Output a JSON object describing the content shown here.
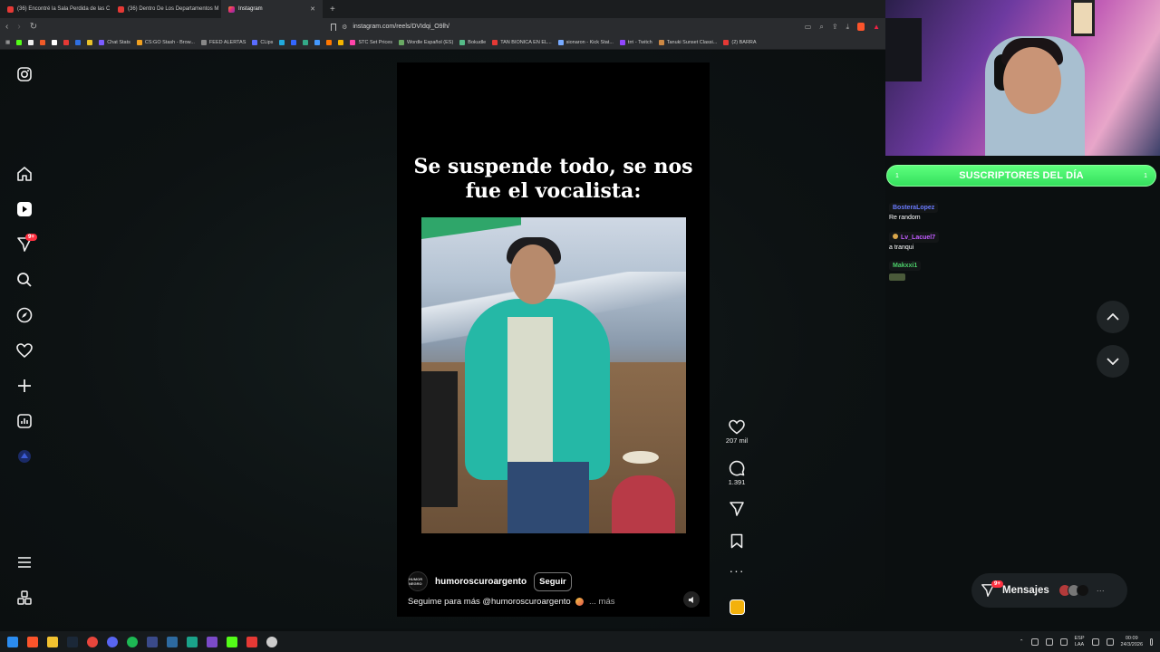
{
  "browser": {
    "tabs": [
      {
        "label": "(36) Encontré la Sala Perdida de las C",
        "active": false
      },
      {
        "label": "(36) Dentro De Los Departamentos M",
        "active": false
      },
      {
        "label": "Instagram",
        "active": true
      }
    ],
    "new_tab_label": "+",
    "url": "instagram.com/reels/DVIdqi_O9lh/",
    "bookmarks": [
      "Chat Stats",
      "CS:GO Stash - Brow...",
      "FEED ALERTAS",
      "CLips",
      "STC Set Prices",
      "Wordle Español (ES)",
      "Bokudle",
      "TAN BIONICA EN EL...",
      "sionaron - Kick Stat...",
      "trri - Twitch",
      "Tanuki Sunset Classi...",
      "(2) BARRA"
    ]
  },
  "instagram": {
    "nav": {
      "logo": "instagram-icon",
      "items": [
        "home-icon",
        "reels-icon",
        "messages-icon",
        "search-icon",
        "explore-icon",
        "notifications-icon",
        "create-icon",
        "dashboard-icon",
        "profile-icon"
      ],
      "messages_badge": "9+",
      "bottom": [
        "more-icon",
        "threads-icon"
      ]
    },
    "reel": {
      "title_line1": "Se suspende todo, se nos",
      "title_line2": "fue el vocalista:",
      "avatar_text": "HUMOR NEGRO",
      "username": "humoroscuroargento",
      "follow_label": "Seguir",
      "description": "Seguime para más @humoroscuroargento",
      "more_label": "... más",
      "likes": "207 mil",
      "comments": "1.391"
    },
    "messages_button": {
      "label": "Mensajes",
      "badge": "9+"
    }
  },
  "stream": {
    "sub_bar": {
      "left_num": "1",
      "title": "SUSCRIPTORES DEL DÍA",
      "right_num": "1"
    },
    "chat": [
      {
        "user": "BosteraLopez",
        "color": "#6a7bff",
        "message": "Re random"
      },
      {
        "user": "Lv_Lacuel7",
        "color": "#c05bff",
        "message": "a tranqui"
      },
      {
        "user": "Makxxi1",
        "color": "#4ccf6a",
        "message": ""
      }
    ]
  },
  "taskbar": {
    "lang_top": "ESP",
    "lang_bottom": "LAA",
    "time": "00:09",
    "date": "24/3/2026"
  }
}
